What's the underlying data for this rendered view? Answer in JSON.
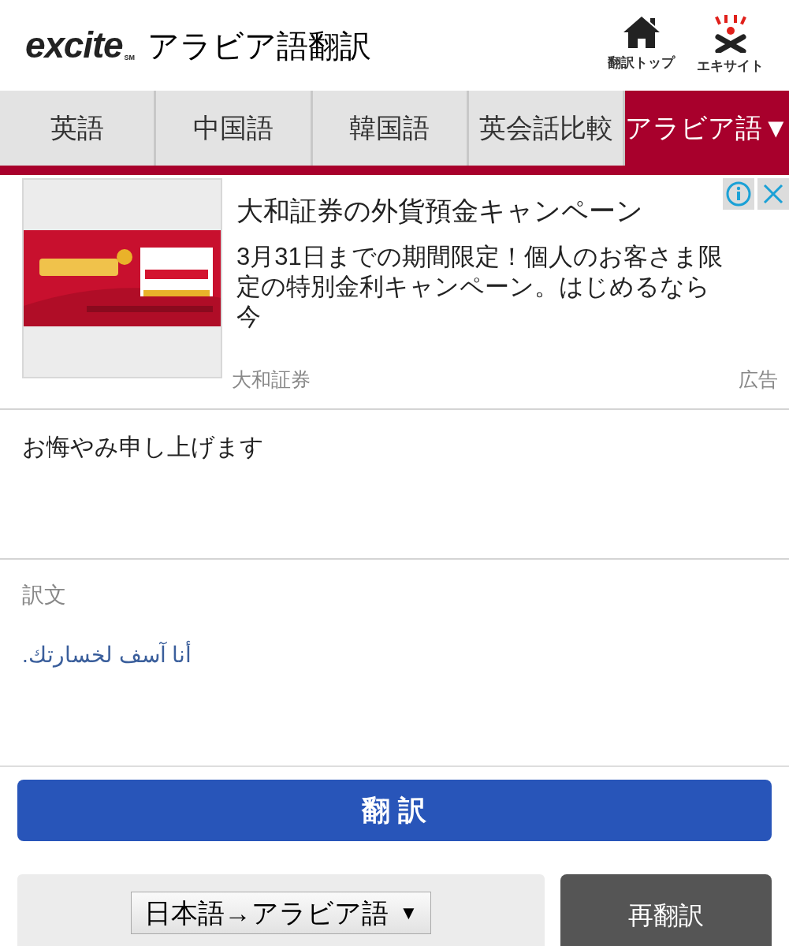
{
  "header": {
    "logo": {
      "text": "excite",
      "mark": "SM"
    },
    "title": "アラビア語翻訳",
    "nav": [
      {
        "label": "翻訳トップ",
        "kind": "home"
      },
      {
        "label": "エキサイト",
        "kind": "brand"
      }
    ]
  },
  "tabs": [
    {
      "label": "英語",
      "selected": false
    },
    {
      "label": "中国語",
      "selected": false
    },
    {
      "label": "韓国語",
      "selected": false
    },
    {
      "label": "英会話比較",
      "selected": false
    },
    {
      "label": "アラビア語▼",
      "selected": true
    }
  ],
  "ad": {
    "headline": "大和証券の外貨預金キャンペーン",
    "body": "3月31日までの期間限定！個人のお客さま限定の特別金利キャンペーン。はじめるなら今",
    "advertiser": "大和証券",
    "label": "広告"
  },
  "input": {
    "value": "お悔やみ申し上げます"
  },
  "result": {
    "label": "訳文",
    "text": "أنا آسف لخسارتك."
  },
  "translate_button": "翻 訳",
  "language_select": {
    "value": "日本語→アラビア語",
    "caret": "▼"
  },
  "retranslate_button": "再翻訳"
}
